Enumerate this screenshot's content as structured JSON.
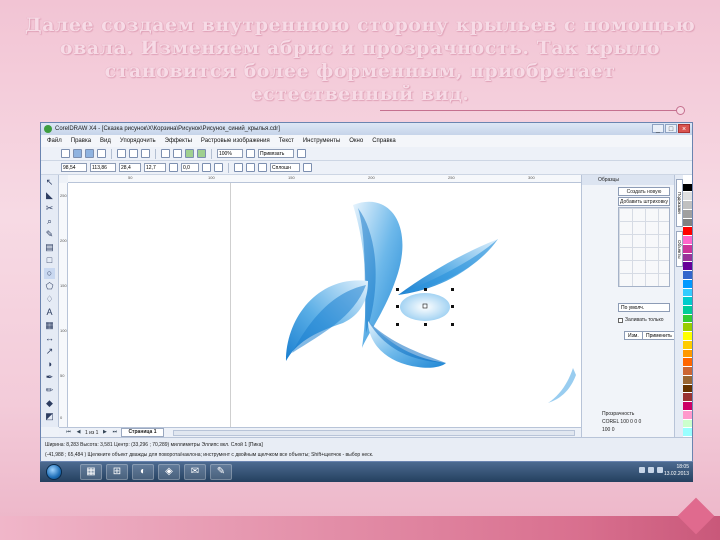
{
  "slide": {
    "heading": "Далее создаем внутреннюю сторону крыльев с помощью овала. Изменяем абрис и прозрачность. Так крыло становится более форменным, приобретает естественный вид."
  },
  "window": {
    "title": "CorelDRAW X4 - [Сказка рисунок\\Х\\Корзина\\Рисунок\\Рисунок_синий_крылья.cdr]",
    "controls": [
      "_",
      "□",
      "×"
    ]
  },
  "menu": [
    "Файл",
    "Правка",
    "Вид",
    "Упорядочить",
    "Эффекты",
    "Растровые изображения",
    "Текст",
    "Инструменты",
    "Окно",
    "Справка"
  ],
  "toolbar": {
    "zoom_value": "100%",
    "snap_label": "Привязать"
  },
  "properties": {
    "x": "98,54",
    "y": "113,86",
    "w": "28,4",
    "h": "12,7",
    "angle": "0,0",
    "outline": "Сплошн"
  },
  "rulers": {
    "h_ticks": [
      "50",
      "100",
      "150",
      "200",
      "250",
      "300"
    ],
    "v_ticks": [
      "250",
      "200",
      "150",
      "100",
      "50",
      "0"
    ]
  },
  "page_nav": {
    "counter": "1 из 1",
    "page_tab": "Страница 1"
  },
  "status": {
    "line1": "Ширина: 8,283  Высота: 3,581  Центр: (33,296 ; 70,289) миллиметры        Эллипс вкл. Слой 1   [Пика]",
    "line2": "(-41,988 ; 65,484 )   Щелкните объект дважды для поворота/наклона; инструмент с двойным щелчком все объекты; Shift+щелчок - выбор неск."
  },
  "docker": {
    "header": "Образцы",
    "button_1": "Создать новую",
    "button_2": "Добавить штриховку",
    "select_value": "По умолч.",
    "checkbox_label": "Заливать только",
    "apply_1": "Изм.",
    "apply_2": "Применить",
    "bottom_1": "Прозрачность",
    "bottom_2": "COREL 100 0 0 0",
    "bottom_3": "100  0"
  },
  "docker_tabs": [
    "Подсказки",
    "Объекты"
  ],
  "palette_colors": [
    "#ffffff",
    "#000000",
    "#e0e0e0",
    "#c0c0c0",
    "#a0a0a0",
    "#808080",
    "#ff0000",
    "#ff66cc",
    "#cc3399",
    "#993399",
    "#660099",
    "#3366cc",
    "#0099ff",
    "#33ccff",
    "#00cccc",
    "#00cc99",
    "#33cc33",
    "#99cc00",
    "#ffff00",
    "#ffcc00",
    "#ff9900",
    "#ff6600",
    "#cc6633",
    "#996633",
    "#663300",
    "#993333",
    "#cc0066",
    "#ff99cc",
    "#ccffcc",
    "#99ffff"
  ],
  "taskbar": {
    "apps": [
      "▦",
      "⊞",
      "◐",
      "◈",
      "✉",
      "✎"
    ],
    "clock": "18:05",
    "date": "13.02.2013"
  }
}
